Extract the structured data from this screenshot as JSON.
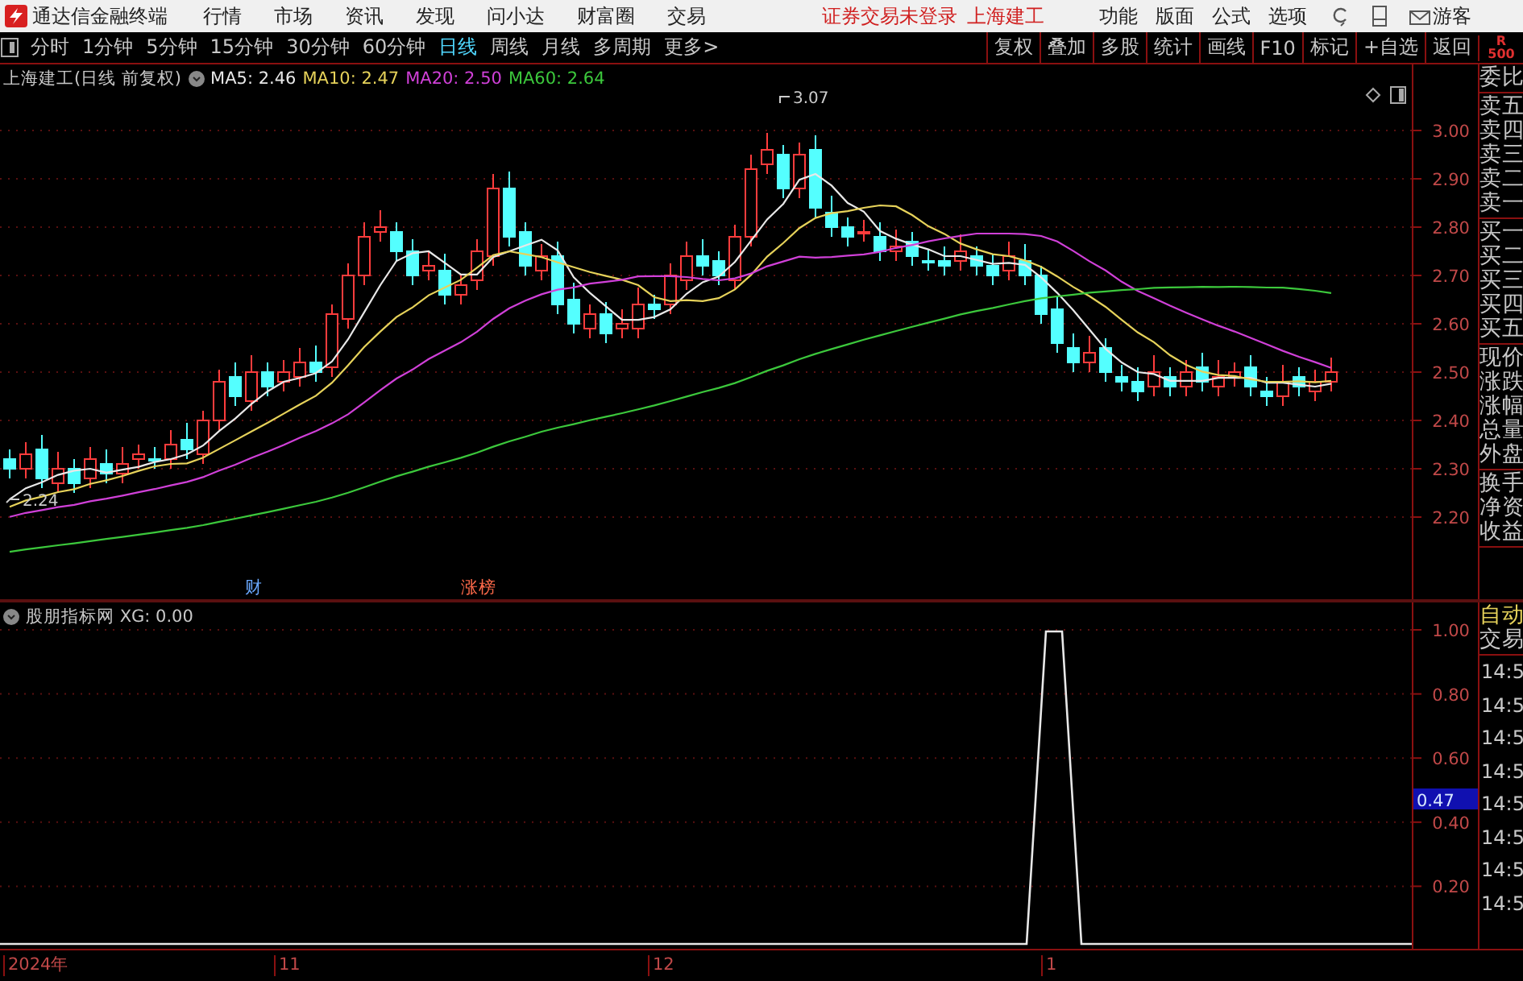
{
  "menubar": {
    "app_title": "通达信金融终端",
    "menus": [
      "行情",
      "市场",
      "资讯",
      "发现",
      "问小达",
      "财富圈",
      "交易"
    ],
    "login_status": "证券交易未登录",
    "stock_name": "上海建工",
    "right_menus": [
      "功能",
      "版面",
      "公式",
      "选项"
    ],
    "user": "游客"
  },
  "toolbar": {
    "periods": [
      {
        "label": "分时",
        "selected": false
      },
      {
        "label": "1分钟",
        "selected": false
      },
      {
        "label": "5分钟",
        "selected": false
      },
      {
        "label": "15分钟",
        "selected": false
      },
      {
        "label": "30分钟",
        "selected": false
      },
      {
        "label": "60分钟",
        "selected": false
      },
      {
        "label": "日线",
        "selected": true
      },
      {
        "label": "周线",
        "selected": false
      },
      {
        "label": "月线",
        "selected": false
      },
      {
        "label": "多周期",
        "selected": false
      },
      {
        "label": "更多>",
        "selected": false
      }
    ],
    "tools": [
      "复权",
      "叠加",
      "多股",
      "统计",
      "画线",
      "F10",
      "标记",
      "+自选",
      "返回"
    ],
    "badge": {
      "line_1": "R",
      "line_2": "500"
    }
  },
  "main_chart": {
    "title": "上海建工(日线 前复权)",
    "moving_averages": [
      {
        "label": "MA5: 2.46",
        "color": "#e8e8e8"
      },
      {
        "label": "MA10: 2.47",
        "color": "#e6d25a"
      },
      {
        "label": "MA20: 2.50",
        "color": "#d040d8"
      },
      {
        "label": "MA60: 2.64",
        "color": "#3cc83c"
      }
    ],
    "y_ticks": [
      "3.00",
      "2.90",
      "2.80",
      "2.70",
      "2.60",
      "2.50",
      "2.40",
      "2.30",
      "2.20"
    ],
    "high_label": "3.07",
    "low_label": "2.24",
    "markers": [
      "财",
      "涨榜"
    ]
  },
  "side_panel": {
    "groups": [
      [
        "委比"
      ],
      [
        "卖五",
        "卖四",
        "卖三",
        "卖二",
        "卖一"
      ],
      [
        "买一",
        "买二",
        "买三",
        "买四",
        "买五"
      ],
      [
        "现价",
        "涨跌",
        "涨幅",
        "总量",
        "外盘"
      ],
      [
        "换手",
        "净资",
        "收益"
      ]
    ],
    "modes": [
      {
        "label": "自动",
        "selected": true
      },
      {
        "label": "交易",
        "selected": false
      }
    ],
    "times": [
      "14:5",
      "14:5",
      "14:5",
      "14:5",
      "14:5",
      "14:5",
      "14:5",
      "14:5"
    ]
  },
  "indicator": {
    "title": "股朋指标网 XG: 0.00",
    "y_ticks": [
      "1.00",
      "0.80",
      "0.60",
      "0.40",
      "0.20"
    ],
    "cursor_value": "0.47"
  },
  "date_axis": [
    "2024年",
    "11",
    "12",
    "1"
  ]
}
